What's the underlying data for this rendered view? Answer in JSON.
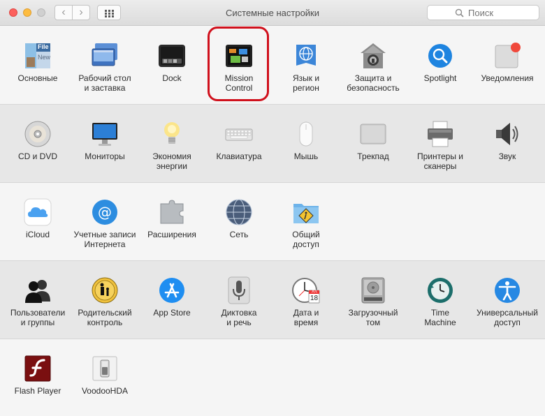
{
  "window": {
    "title": "Системные настройки",
    "search_placeholder": "Поиск"
  },
  "rows": [
    [
      {
        "label": "Основные",
        "icon": "general-icon"
      },
      {
        "label": "Рабочий стол\nи заставка",
        "icon": "desktop-screensaver-icon"
      },
      {
        "label": "Dock",
        "icon": "dock-icon"
      },
      {
        "label": "Mission\nControl",
        "icon": "mission-control-icon"
      },
      {
        "label": "Язык и\nрегион",
        "icon": "language-region-icon"
      },
      {
        "label": "Защита и\nбезопасность",
        "icon": "security-icon"
      },
      {
        "label": "Spotlight",
        "icon": "spotlight-icon"
      },
      {
        "label": "Уведомления",
        "icon": "notifications-icon"
      }
    ],
    [
      {
        "label": "CD и DVD",
        "icon": "cd-dvd-icon"
      },
      {
        "label": "Мониторы",
        "icon": "displays-icon"
      },
      {
        "label": "Экономия\nэнергии",
        "icon": "energy-saver-icon"
      },
      {
        "label": "Клавиатура",
        "icon": "keyboard-icon"
      },
      {
        "label": "Мышь",
        "icon": "mouse-icon"
      },
      {
        "label": "Трекпад",
        "icon": "trackpad-icon"
      },
      {
        "label": "Принтеры и\nсканеры",
        "icon": "printer-icon"
      },
      {
        "label": "Звук",
        "icon": "sound-icon"
      }
    ],
    [
      {
        "label": "iCloud",
        "icon": "icloud-icon"
      },
      {
        "label": "Учетные записи\nИнтернета",
        "icon": "internet-accounts-icon"
      },
      {
        "label": "Расширения",
        "icon": "extensions-icon"
      },
      {
        "label": "Сеть",
        "icon": "network-icon"
      },
      {
        "label": "Общий\nдоступ",
        "icon": "sharing-icon"
      }
    ],
    [
      {
        "label": "Пользователи\nи группы",
        "icon": "users-groups-icon"
      },
      {
        "label": "Родительский\nконтроль",
        "icon": "parental-controls-icon"
      },
      {
        "label": "App Store",
        "icon": "app-store-icon"
      },
      {
        "label": "Диктовка\nи речь",
        "icon": "dictation-icon"
      },
      {
        "label": "Дата и\nвремя",
        "icon": "date-time-icon"
      },
      {
        "label": "Загрузочный\nтом",
        "icon": "startup-disk-icon"
      },
      {
        "label": "Time\nMachine",
        "icon": "time-machine-icon"
      },
      {
        "label": "Универсальный\nдоступ",
        "icon": "accessibility-icon"
      }
    ],
    [
      {
        "label": "Flash Player",
        "icon": "flash-player-icon"
      },
      {
        "label": "VoodooHDA",
        "icon": "voodoohda-icon"
      }
    ]
  ],
  "icon_text": {
    "general_file": "File",
    "general_new": "New",
    "calendar_month": "JUL",
    "calendar_day": "18"
  },
  "highlighted_pane": "Mission Control",
  "colors": {
    "highlight": "#d0101c",
    "close": "#fc605c",
    "minimize": "#fdbc40",
    "zoom": "#d0d0d0"
  }
}
